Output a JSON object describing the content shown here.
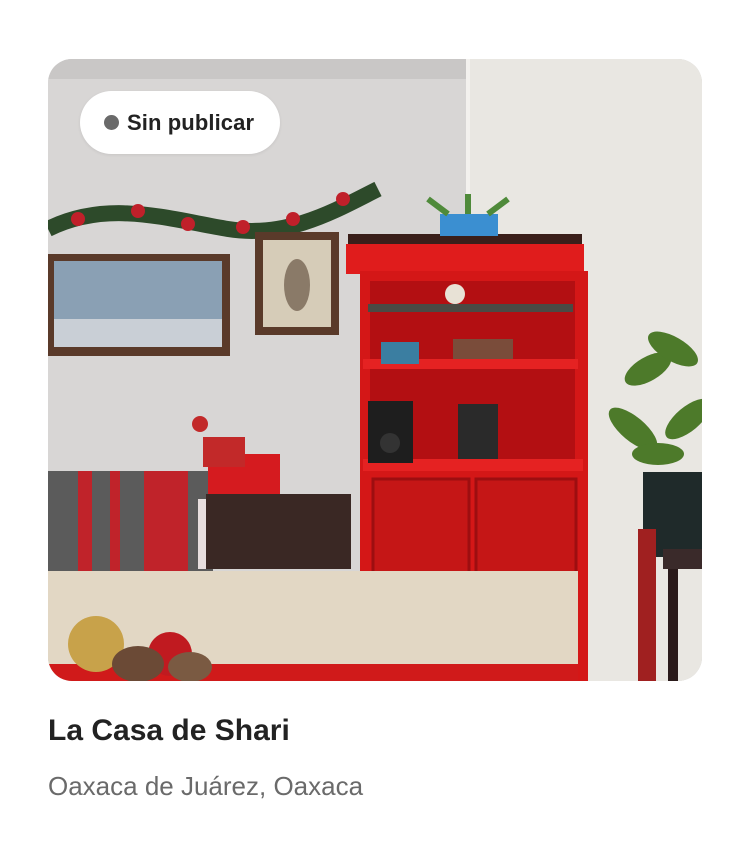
{
  "listing": {
    "status_label": "Sin publicar",
    "status_dot_color": "#6a6a6a",
    "title": "La Casa de Shari",
    "location": "Oaxaca de Juárez, Oaxaca",
    "photo_description_icon": "listing-photo"
  },
  "colors": {
    "title": "#222222",
    "subtitle": "#6a6a6a",
    "background": "#ffffff"
  }
}
